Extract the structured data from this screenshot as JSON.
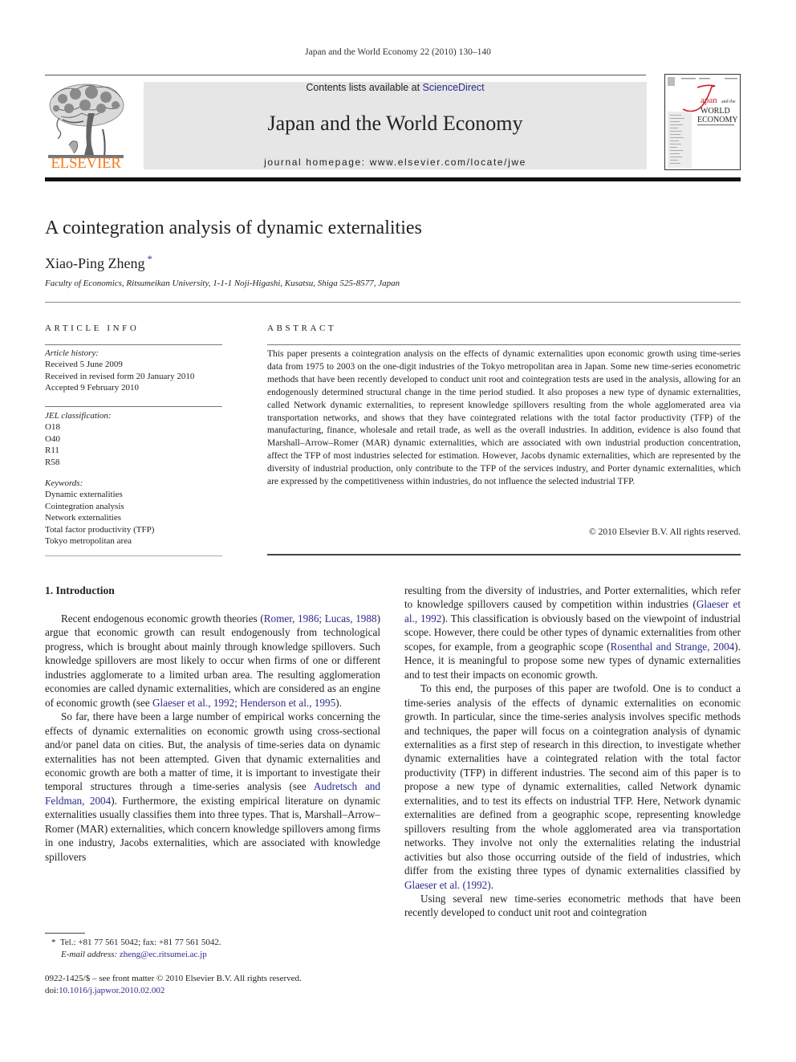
{
  "running_head": "Japan and the World Economy 22 (2010) 130–140",
  "masthead": {
    "publisher_logo_text": "ELSEVIER",
    "contents_prefix": "Contents lists available at ",
    "contents_link": "ScienceDirect",
    "journal_title": "Japan and the World Economy",
    "homepage": "journal homepage: www.elsevier.com/locate/jwe",
    "cover": {
      "j_letter": "J",
      "title_line1": "apan",
      "title_and": "and the",
      "title_line2": "WORLD",
      "title_line3": "ECONOMY"
    }
  },
  "colors": {
    "elsevier_orange": "#f47b20",
    "link_blue": "#2a2a8c",
    "masthead_gray": "#e6e6e6",
    "cover_red": "#c8202a"
  },
  "article": {
    "title": "A cointegration analysis of dynamic externalities",
    "author": "Xiao-Ping Zheng",
    "author_mark": "*",
    "affiliation": "Faculty of Economics, Ritsumeikan University, 1-1-1 Noji-Higashi, Kusatsu, Shiga 525-8577, Japan"
  },
  "article_info": {
    "heading": "ARTICLE INFO",
    "history_label": "Article history:",
    "history": [
      "Received 5 June 2009",
      "Received in revised form 20 January 2010",
      "Accepted 9 February 2010"
    ],
    "jel_label": "JEL classification:",
    "jel": [
      "O18",
      "O40",
      "R11",
      "R58"
    ],
    "keywords_label": "Keywords:",
    "keywords": [
      "Dynamic externalities",
      "Cointegration analysis",
      "Network externalities",
      "Total factor productivity (TFP)",
      "Tokyo metropolitan area"
    ]
  },
  "abstract": {
    "heading": "ABSTRACT",
    "text": "This paper presents a cointegration analysis on the effects of dynamic externalities upon economic growth using time-series data from 1975 to 2003 on the one-digit industries of the Tokyo metropolitan area in Japan. Some new time-series econometric methods that have been recently developed to conduct unit root and cointegration tests are used in the analysis, allowing for an endogenously determined structural change in the time period studied. It also proposes a new type of dynamic externalities, called Network dynamic externalities, to represent knowledge spillovers resulting from the whole agglomerated area via transportation networks, and shows that they have cointegrated relations with the total factor productivity (TFP) of the manufacturing, finance, wholesale and retail trade, as well as the overall industries. In addition, evidence is also found that Marshall–Arrow–Romer (MAR) dynamic externalities, which are associated with own industrial production concentration, affect the TFP of most industries selected for estimation. However, Jacobs dynamic externalities, which are represented by the diversity of industrial production, only contribute to the TFP of the services industry, and Porter dynamic externalities, which are expressed by the competitiveness within industries, do not influence the selected industrial TFP.",
    "copyright": "© 2010 Elsevier B.V. All rights reserved."
  },
  "body": {
    "intro_heading": "1.  Introduction",
    "p1": {
      "a": "Recent endogenous economic growth theories (",
      "cite1": "Romer, 1986; Lucas, 1988",
      "b": ") argue that economic growth can result endogenously from technological progress, which is brought about mainly through knowledge spillovers. Such knowledge spillovers are most likely to occur when firms of one or different industries agglomerate to a limited urban area. The resulting agglomeration economies are called dynamic externalities, which are considered as an engine of economic growth (see ",
      "cite2": "Glaeser et al., 1992; Henderson et al., 1995",
      "c": ")."
    },
    "p2": {
      "a": "So far, there have been a large number of empirical works concerning the effects of dynamic externalities on economic growth using cross-sectional and/or panel data on cities. But, the analysis of time-series data on dynamic externalities has not been attempted. Given that dynamic externalities and economic growth are both a matter of time, it is important to investigate their temporal structures through a time-series analysis (see ",
      "cite1": "Audretsch and Feldman, 2004",
      "b": "). Furthermore, the existing empirical literature on dynamic externalities usually classifies them into three types. That is, Marshall–Arrow–Romer (MAR) externalities, which concern knowledge spillovers among firms in one industry, Jacobs externalities, which are associated with knowledge spillovers resulting from the diversity of industries, and Porter externalities, which refer to knowledge spillovers caused by competition within industries (",
      "cite2": "Glaeser et al., 1992",
      "c": "). This classification is obviously based on the viewpoint of industrial scope. However, there could be other types of dynamic externalities from other scopes, for example, from a geographic scope (",
      "cite3": "Rosenthal and Strange, 2004",
      "d": "). Hence, it is meaningful to propose some new types of dynamic externalities and to test their impacts on economic growth."
    },
    "p3": {
      "a": "To this end, the purposes of this paper are twofold. One is to conduct a time-series analysis of the effects of dynamic externalities on economic growth. In particular, since the time-series analysis involves specific methods and techniques, the paper will focus on a cointegration analysis of dynamic externalities as a first step of research in this direction, to investigate whether dynamic externalities have a cointegrated relation with the total factor productivity (TFP) in different industries. The second aim of this paper is to propose a new type of dynamic externalities, called Network dynamic externalities, and to test its effects on industrial TFP. Here, Network dynamic externalities are defined from a geographic scope, representing knowledge spillovers resulting from the whole agglomerated area via transportation networks. They involve not only the externalities relating the industrial activities but also those occurring outside of the field of industries, which differ from the existing three types of dynamic externalities classified by ",
      "cite1": "Glaeser et al. (1992)",
      "b": "."
    },
    "p4": {
      "a": "Using several new time-series econometric methods that have been recently developed to conduct unit root and cointegration"
    }
  },
  "footnote": {
    "mark": "*",
    "contact": "Tel.: +81 77 561 5042; fax: +81 77 561 5042.",
    "email_label": "E-mail address: ",
    "email": "zheng@ec.ritsumei.ac.jp"
  },
  "front_matter": {
    "issn_line": "0922-1425/$ – see front matter © 2010 Elsevier B.V. All rights reserved.",
    "doi_prefix": "doi:",
    "doi": "10.1016/j.japwor.2010.02.002"
  }
}
